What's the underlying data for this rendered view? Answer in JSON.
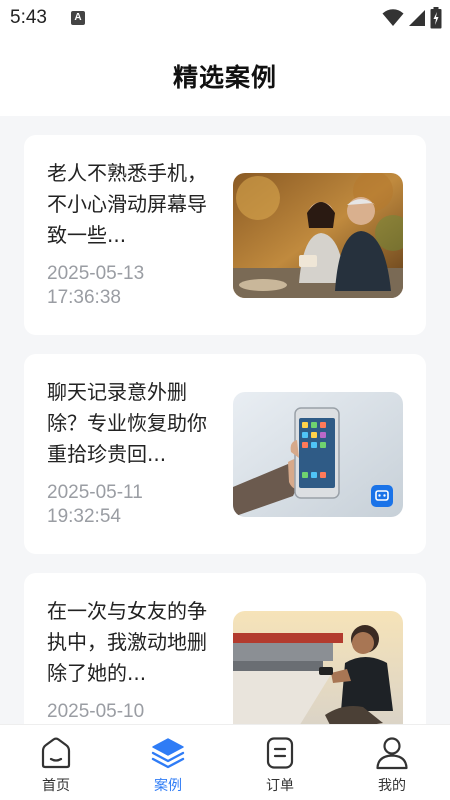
{
  "status_bar": {
    "time": "5:43",
    "notification_badge": "A"
  },
  "header": {
    "title": "精选案例"
  },
  "cases": [
    {
      "title": "老人不熟悉手机，不小心滑动屏幕导致一些...",
      "date": "2025-05-13 17:36:38"
    },
    {
      "title": "聊天记录意外删除？专业恢复助你重拾珍贵回...",
      "date": "2025-05-11 19:32:54"
    },
    {
      "title": "在一次与女友的争执中，我激动地删除了她的...",
      "date": "2025-05-10"
    }
  ],
  "tabs": [
    {
      "label": "首页",
      "icon": "home-icon",
      "active": false
    },
    {
      "label": "案例",
      "icon": "layers-icon",
      "active": true
    },
    {
      "label": "订单",
      "icon": "order-icon",
      "active": false
    },
    {
      "label": "我的",
      "icon": "profile-icon",
      "active": false
    }
  ],
  "colors": {
    "accent": "#2f7cf6",
    "background": "#f5f6f8",
    "card": "#ffffff",
    "muted_text": "#9a9da3"
  }
}
